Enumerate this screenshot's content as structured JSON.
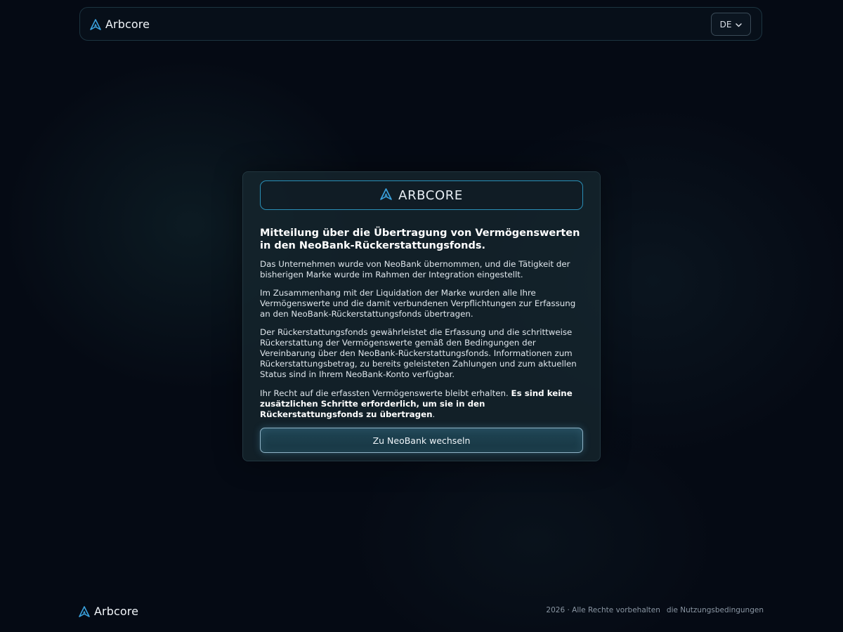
{
  "header": {
    "brand_name": "Arbcore",
    "language": "DE"
  },
  "card": {
    "logo_text": "ARBCORE",
    "title": "Mitteilung über die Übertragung von Vermögenswerten in den NeoBank-Rückerstattungsfonds.",
    "paragraph_1": "Das Unternehmen wurde von NeoBank übernommen, und die Tätigkeit der bisherigen Marke wurde im Rahmen der Integration eingestellt.",
    "paragraph_2": "Im Zusammenhang mit der Liquidation der Marke wurden alle Ihre Vermögenswerte und die damit verbundenen Verpflichtungen zur Erfassung an den NeoBank-Rückerstattungsfonds übertragen.",
    "paragraph_3": "Der Rückerstattungsfonds gewährleistet die Erfassung und die schrittweise Rückerstattung der Vermögenswerte gemäß den Bedingungen der Vereinbarung über den NeoBank-Rückerstattungsfonds. Informationen zum Rückerstattungsbetrag, zu bereits geleisteten Zahlungen und zum aktuellen Status sind in Ihrem NeoBank-Konto verfügbar.",
    "paragraph_4_lead": "Ihr Recht auf die erfassten Vermögenswerte bleibt erhalten. ",
    "paragraph_4_bold": "Es sind keine zusätzlichen Schritte erforderlich, um sie in den Rückerstattungsfonds zu übertragen",
    "paragraph_4_end": ".",
    "button_label": "Zu NeoBank wechseln"
  },
  "footer": {
    "brand_name": "Arbcore",
    "copyright": "2026 · Alle Rechte vorbehalten",
    "terms_link": "die Nutzungsbedingungen"
  },
  "colors": {
    "accent": "#3aa0dc",
    "background": "#050a14"
  },
  "icons": {
    "logo": "arbcore-triangle-logo-icon",
    "language_chevron": "chevron-down-icon"
  }
}
